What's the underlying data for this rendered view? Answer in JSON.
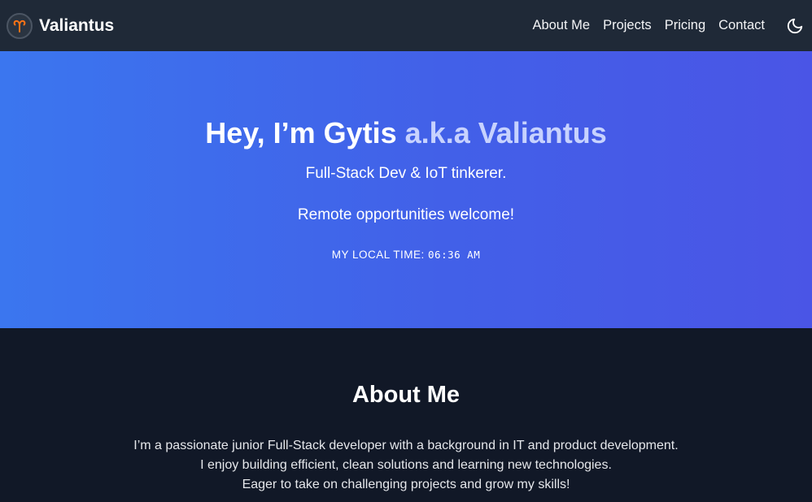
{
  "nav": {
    "brand": "Valiantus",
    "logo_icon": "aries-icon",
    "links": [
      "About Me",
      "Projects",
      "Pricing",
      "Contact"
    ],
    "theme_icon": "moon-icon"
  },
  "hero": {
    "title_main": "Hey, I’m Gytis",
    "title_alias": "a.k.a Valiantus",
    "subtitle": "Full-Stack Dev & IoT tinkerer.",
    "remote": "Remote opportunities welcome!",
    "time_label": "MY LOCAL TIME:",
    "time_value": "06:36 AM"
  },
  "about": {
    "title": "About Me",
    "lines": [
      "I’m a passionate junior Full-Stack developer with a background in IT and product development.",
      "I enjoy building efficient, clean solutions and learning new technologies.",
      "Eager to take on challenging projects and grow my skills!"
    ]
  },
  "colors": {
    "navbar": "#1f2937",
    "hero_start": "#3b76ef",
    "hero_end": "#4a55e6",
    "alias": "#c7d2fe",
    "logo_accent": "#f97316",
    "page_bg": "#111827"
  }
}
